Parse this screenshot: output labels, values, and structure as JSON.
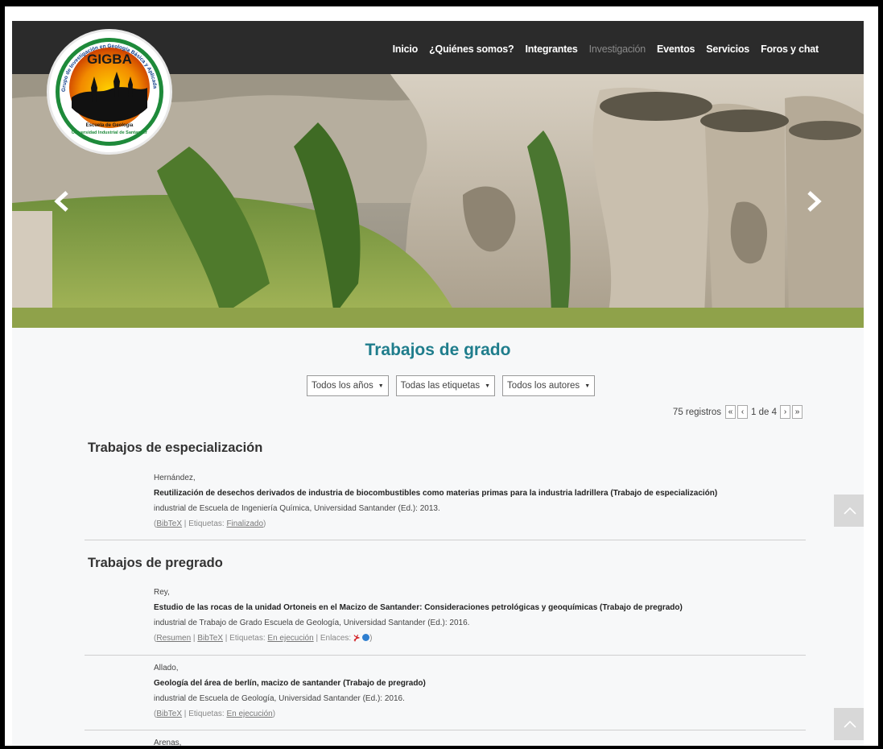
{
  "nav": {
    "items": [
      {
        "label": "Inicio",
        "active": false
      },
      {
        "label": "¿Quiénes somos?",
        "active": false
      },
      {
        "label": "Integrantes",
        "active": false
      },
      {
        "label": "Investigación",
        "active": true
      },
      {
        "label": "Eventos",
        "active": false
      },
      {
        "label": "Servicios",
        "active": false
      },
      {
        "label": "Foros y chat",
        "active": false
      }
    ]
  },
  "logo": {
    "name": "GIGBA",
    "ring_text": "Grupo de Investigación en Geología Básica y Aplicada",
    "school": "Escuela de Geología",
    "university": "Universidad Industrial de Santander"
  },
  "page": {
    "title": "Trabajos de grado"
  },
  "filters": [
    "Todos los años",
    "Todas las etiquetas",
    "Todos los autores"
  ],
  "pager": {
    "count": "75 registros",
    "first": "«",
    "prev": "‹",
    "page": "1 de 4",
    "next": "›",
    "last": "»"
  },
  "sections": [
    {
      "heading": "Trabajos de especialización",
      "entries": [
        {
          "author": "Hernández,",
          "title": "Reutilización de desechos derivados de industria de biocombustibles como materias primas para la industria ladrillera (Trabajo de especialización)",
          "publisher": "industrial de Escuela de Ingeniería Química, Universidad Santander (Ed.): 2013.",
          "bibtex": "BibTeX",
          "tags_label": "Etiquetas:",
          "tag": "Finalizado"
        }
      ]
    },
    {
      "heading": "Trabajos de pregrado",
      "entries": [
        {
          "author": "Rey,",
          "title": "Estudio de las rocas de la unidad Ortoneis en el Macizo de Santander: Consideraciones petrológicas y geoquímicas (Trabajo de pregrado)",
          "publisher": "industrial de Trabajo de Grado Escuela de Geología, Universidad Santander (Ed.): 2016.",
          "resumen": "Resumen",
          "bibtex": "BibTeX",
          "tags_label": "Etiquetas:",
          "tag": "En ejecución",
          "links_label": "Enlaces:"
        },
        {
          "author": "Allado,",
          "title": "Geología del área de berlín, macizo de santander (Trabajo de pregrado)",
          "publisher": "industrial de Escuela de Geología, Universidad Santander (Ed.): 2016.",
          "bibtex": "BibTeX",
          "tags_label": "Etiquetas:",
          "tag": "En ejecución"
        },
        {
          "author": "Arenas,"
        }
      ]
    }
  ],
  "colors": {
    "title": "#1f7d8c",
    "navbar": "#2b2b2b",
    "page_bg": "#f7f8f9"
  }
}
